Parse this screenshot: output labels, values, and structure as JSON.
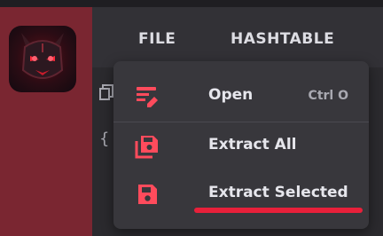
{
  "menu_bar": {
    "file_label": "FILE",
    "hashtable_label": "HASHTABLE"
  },
  "sidebar": {
    "logo_icon": "demon-face-logo"
  },
  "partial_icons": [
    "copy-icon",
    "braces-icon"
  ],
  "partial_text": {
    "brace": "{"
  },
  "file_menu": {
    "items": [
      {
        "label": "Open",
        "shortcut": "Ctrl O",
        "icon": "edit-document-icon"
      },
      {
        "label": "Extract All",
        "icon": "save-multiple-icon"
      },
      {
        "label": "Extract Selected",
        "icon": "save-icon"
      }
    ]
  },
  "colors": {
    "accent": "#ff4b5c",
    "sidebar": "#7a2631",
    "highlight_underline": "#e8203a"
  }
}
